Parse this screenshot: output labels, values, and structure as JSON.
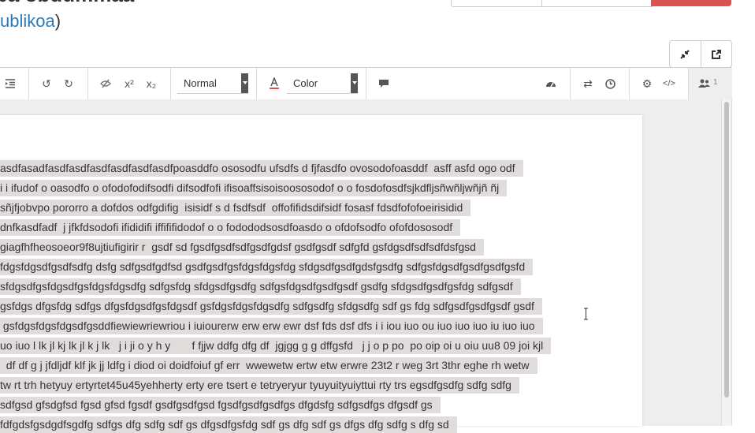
{
  "header": {
    "title": "pa obdummaa",
    "subtitle_link": "ublikoa",
    "subtitle_close": ")"
  },
  "toolbar": {
    "format_select": "Normal",
    "color_select": "Color",
    "user_count": "1"
  },
  "editor": {
    "lines": [
      "asdfasadfasdfasdfasdfasdfasdfasdfpoasddfo ososodfu ufsdfs d fjfasdfo ovosodofoasddf  asff asfd ogo odf",
      "i i ifudof o oasodfo o ofodofodifsodfi difsodfofi ifisoaffsisoisoososodof o o fosdofosdfsjkdfljsñwñljwñjñ ñj",
      "sñjfjobvpo pororro a dofdos odfgdifig  isisidf s d fsdfsdf  offofifidsdifsidf fosasf fdsdfofofoeirisidid",
      "dnfkasdfadf  j jfkfdsodofi ifididifi iffififidodof o o fodododsosdfoasdo o ofdofsodfo ofofdososodf",
      "giagfhfheosoeor9f8ujtiufigirir r  gsdf sd fgsdfgsdfsdfgsdfgdsf gsdfgsdf sdfgfd gsfdgsdfsdfsdfdsfgsd",
      "fdgsfdgsdfgsdfsdfg dsfg sdfgsdfgdfsd gsdfgsdfgsfdgsfdgsfdg sfdgsdfgsdfgdsfgsdfg sdfgsfdgsdfgsdfgsdfgsfd",
      "sfdgsdfgsfdgsdfgsfdgsfdgsdfg sdfgsfdg sfdgsdfgsdfg sdfgsfdgsdfgsdfgsdf gsdfg sfdgsdfgsdfgsfdg sdfgsdf",
      "gsfdgs dfgsfdg sdfgs dfgsfdgsdfgsfdgsdf gsfdgsfdgsfdgsdfg sdfgsdfg sfdgsdfg sdf gs fdg sdfgsdfgsdfgsdf gsdf",
      " gsfdgsfdgsfdgsdfgsddfiewiewriewriou i iuiourerw erw erw ewr dsf fds dsf dfs i i iou iuo ou iuo iuo iuo iu iuo iuo",
      "uo iuo l lk jl kj lk jl k j lk   j i ji o y h y       f fjjw ddfg dfg df  jgjgg g g dffgsfd   j j o p po  po oip oi u oiu uu8 09 joi kjl",
      "  df df g j jfdljdf klf jk jj ldfg i diod oi doidfoiuf gf err  wwewetw ertw etw erwre 23t2 r weg 3rt 3thr eghe rh wetw",
      "tw rt trh hetyuy ertyrtet45u45yehherty erty ere tsert e tetryeryur tyuyuityuiyttui rty trs egsdfgsdfg sdfg sdfg",
      "sdfgsd gfsdgfsd fgsd gfsd fgsdf gsdfgsdfgsd fgsdfgsdfgsdfgs dfgdsfg sdfgsdfgs dfgsdf gs",
      "fdfgdsfgsdgdfsgdfg sdfgs dfg sdfg sdf gs dfgsdfgsfdg sdf gs dfg sdf gs dfgs dfg sdfg s dfg sd"
    ]
  }
}
